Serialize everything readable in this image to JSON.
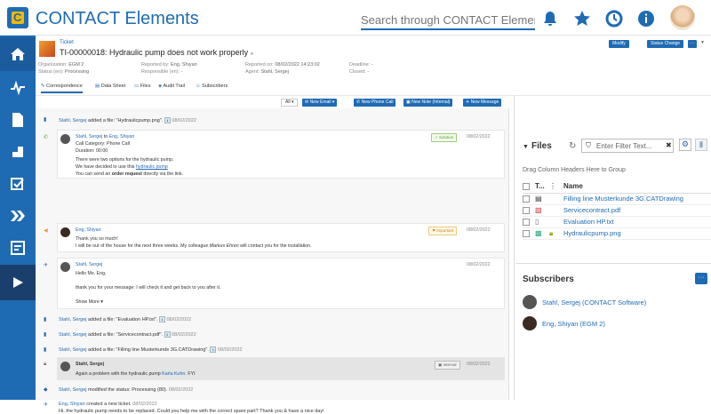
{
  "app": {
    "title": "CONTACT Elements",
    "search_placeholder": "Search through CONTACT Elements ..."
  },
  "ticket": {
    "type": "Ticket",
    "title": "TI-00000018: Hydraulic pump does not work properly",
    "fields": {
      "org_label": "Organization:",
      "org_value": "EGM 2",
      "status_label": "Status (en):",
      "status_value": "Processing",
      "reported_by_label": "Reported by:",
      "reported_by_value": "Eng, Shiyan",
      "responsible_label": "Responsible (en):",
      "responsible_value": "-",
      "reported_on_label": "Reported on:",
      "reported_on_value": "08/02/2022 14:23:02",
      "agent_label": "Agent:",
      "agent_value": "Stahl, Sergej",
      "deadline_label": "Deadline:",
      "deadline_value": "-",
      "closed_label": "Closed:",
      "closed_value": "-"
    },
    "buttons": {
      "modify": "Modify",
      "status_change": "Status Change"
    }
  },
  "tabs": [
    "Correspondence",
    "Data Sheet",
    "Files",
    "Audit Trail",
    "Subscribers"
  ],
  "toolbar": {
    "filter": "All",
    "new_email": "New Email",
    "new_phone": "New Phone Call",
    "new_note": "New Note (Internal)",
    "new_message": "New Message"
  },
  "activities": {
    "a1": {
      "user": "Stahl, Sergej",
      "text": " added a file: \"Hydraulicpump.png\".",
      "date": "08/02/2022"
    },
    "call": {
      "from": "Stahl, Sergej",
      "to_word": " to ",
      "to": "Eng, Shiyan",
      "badge": "Solution",
      "date": "08/02/2022",
      "l1": "Call Category: Phone Call",
      "l2": "Duration: 00:00",
      "l3": "There were two options for the hydraulic pump.",
      "l4a": "We have decided to use this ",
      "l4link": "hydraulic pump",
      "l5a": "You can send an ",
      "l5b": "order request",
      "l5c": " directly via the link."
    },
    "imp": {
      "user": "Eng, Shiyan",
      "badge": "Important",
      "date": "08/02/2022",
      "l1": "Thank you so much!",
      "l2a": "I will be out of the house for the next three weeks. My colleague ",
      "l2b": "Markus Ehren",
      "l2c": " will contact you for the installation."
    },
    "msg": {
      "user": "Stahl, Sergej",
      "date": "08/02/2022",
      "l1": "Hello Ms. Eng,",
      "l2": "thank you for your message: I will check it and get back to you after it.",
      "more": "Show More"
    },
    "a2": {
      "user": "Stahl, Sergej",
      "text": " added a file: \"Evaluation HP.txt\".",
      "date": "08/02/2022"
    },
    "a3": {
      "user": "Stahl, Sergej",
      "text": " added a file: \"Servicecontract.pdf\".",
      "date": "08/02/2022"
    },
    "a4": {
      "user": "Stahl, Sergej",
      "text": " added a file: \"Filling line Musterkunde 3G.CATDrawing\".",
      "date": "08/02/2022"
    },
    "note": {
      "user": "Stahl, Sergej",
      "badge": "Internal",
      "date": "08/02/2022",
      "l1a": "Again a problem with the hydraulic pump ",
      "l1b": "Karla Kuhn",
      "l1c": ". FYI"
    },
    "a5": {
      "user": "Stahl, Sergej",
      "text": " modified the status: Processing (80).",
      "date": "08/02/2022"
    },
    "a6": {
      "user": "Eng, Shiyan",
      "text": " created a new ticket.",
      "date": "08/02/2022",
      "body": "Hi, the hydraulic pump needs to be replaced. Could you help me with the correct spare part? Thank you & have a nice day!"
    }
  },
  "files": {
    "title": "Files",
    "filter_placeholder": "Enter Filter Text...",
    "group_hint": "Drag Column Headers Here to Group",
    "col_type": "T...",
    "col_name": "Name",
    "rows": [
      "Filling line Musterkunde 3G.CATDrawing",
      "Servicecontract.pdf",
      "Evaluation HP.txt",
      "Hydraulicpump.png"
    ]
  },
  "subscribers": {
    "title": "Subscribers",
    "items": [
      "Stahl, Sergej (CONTACT Software)",
      "Eng, Shiyan (EGM 2)"
    ]
  }
}
